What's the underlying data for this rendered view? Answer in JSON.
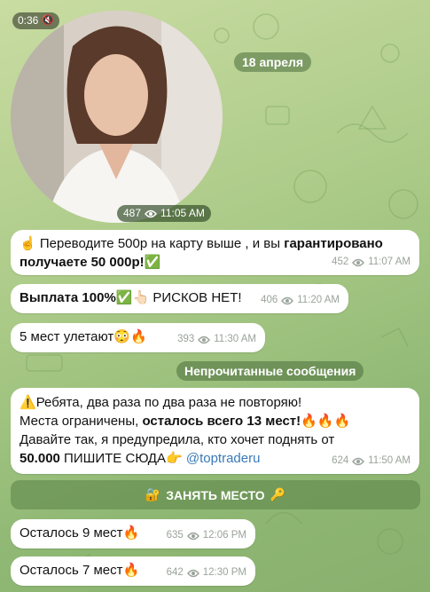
{
  "video": {
    "duration": "0:36",
    "views": "487",
    "time": "11:05 AM"
  },
  "date_label": "18 апреля",
  "unread_label": "Непрочитанные сообщения",
  "messages": [
    {
      "emoji_lead": "☝️",
      "text_a": " Переводите 500р на карту выше , и вы ",
      "bold": "гарантировано получаете 50 000р!",
      "emoji_end": "✅",
      "views": "452",
      "time": "11:07 AM"
    },
    {
      "bold": "Выплата 100%",
      "emoji_mid": "✅👆🏻",
      "text": " РИСКОВ НЕТ!",
      "views": "406",
      "time": "11:20 AM"
    },
    {
      "text": "5 мест улетают",
      "emoji": "😳🔥",
      "views": "393",
      "time": "11:30 AM"
    },
    {
      "line1_emoji": "⚠️",
      "line1": "Ребята, два раза по два раза не повторяю!",
      "line2_a": "Места ограничены, ",
      "line2_bold": "осталось всего 13 мест!",
      "line2_emoji": "🔥🔥🔥",
      "line3": "Давайте так, я предупредила, кто хочет поднять от",
      "line4_bold": "50.000",
      "line4": " ПИШИТЕ СЮДА",
      "line4_emoji": "👉",
      "link": "@toptraderu",
      "views": "624",
      "time": "11:50 AM"
    },
    {
      "text": "Осталось 9 мест",
      "emoji": "🔥",
      "views": "635",
      "time": "12:06 PM"
    },
    {
      "text": "Осталось 7 мест",
      "emoji": "🔥",
      "views": "642",
      "time": "12:30 PM"
    }
  ],
  "button": {
    "icon_left": "🔐",
    "label": "ЗАНЯТЬ МЕСТО",
    "icon_right": "🔑"
  }
}
